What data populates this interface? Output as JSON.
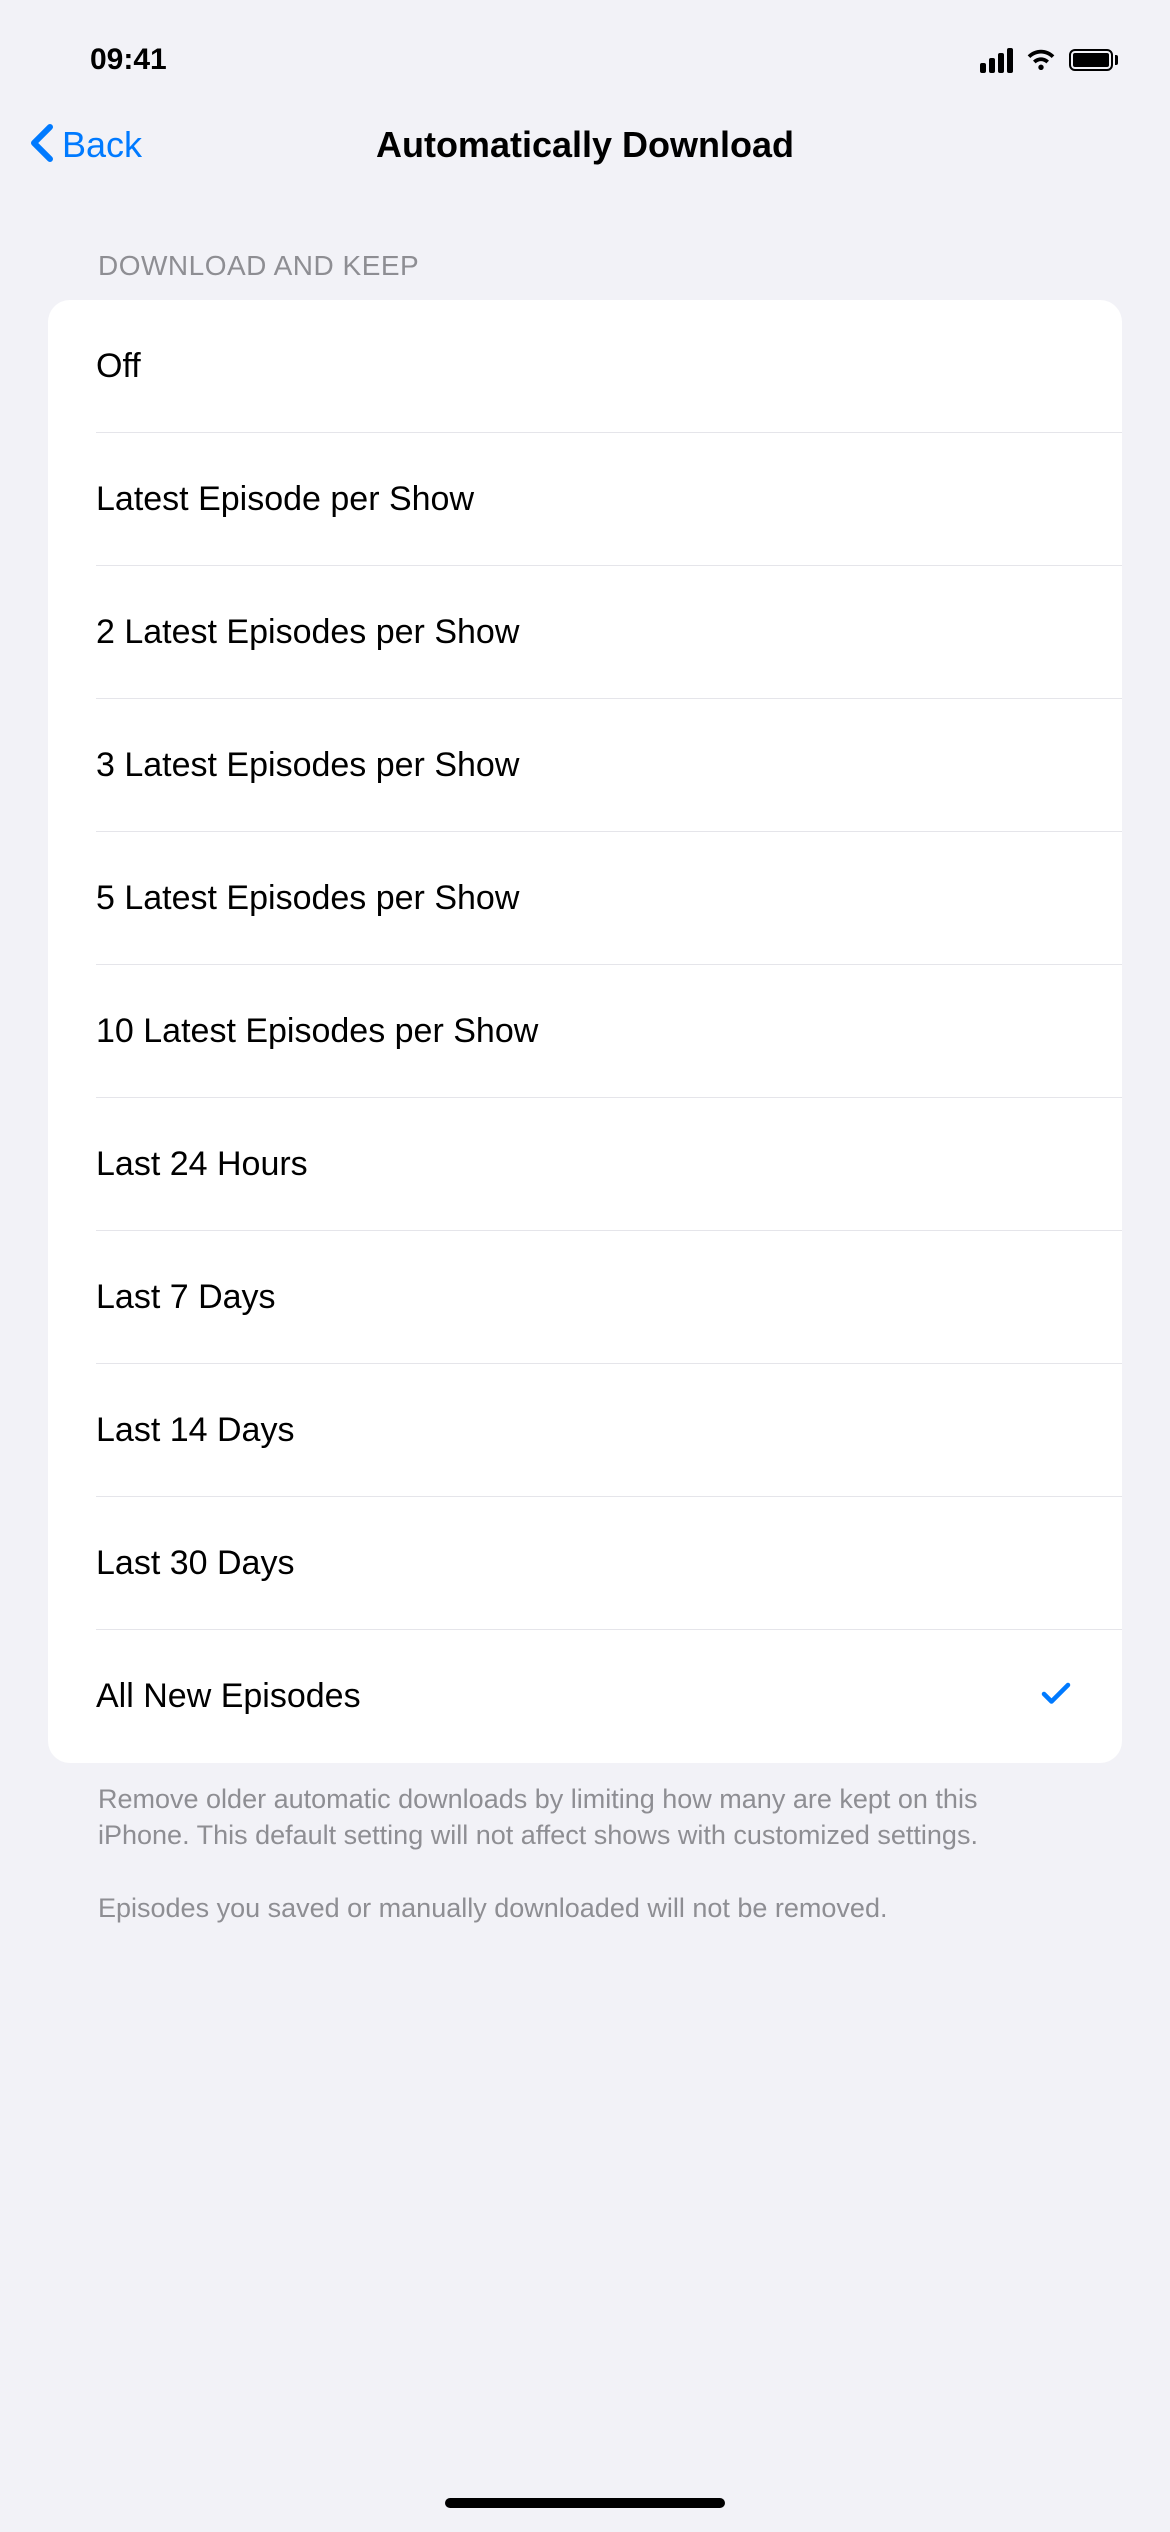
{
  "statusBar": {
    "time": "09:41"
  },
  "navBar": {
    "backLabel": "Back",
    "title": "Automatically Download"
  },
  "section": {
    "header": "DOWNLOAD AND KEEP",
    "options": [
      {
        "label": "Off",
        "selected": false
      },
      {
        "label": "Latest Episode per Show",
        "selected": false
      },
      {
        "label": "2 Latest Episodes per Show",
        "selected": false
      },
      {
        "label": "3 Latest Episodes per Show",
        "selected": false
      },
      {
        "label": "5 Latest Episodes per Show",
        "selected": false
      },
      {
        "label": "10 Latest Episodes per Show",
        "selected": false
      },
      {
        "label": "Last 24 Hours",
        "selected": false
      },
      {
        "label": "Last 7 Days",
        "selected": false
      },
      {
        "label": "Last 14 Days",
        "selected": false
      },
      {
        "label": "Last 30 Days",
        "selected": false
      },
      {
        "label": "All New Episodes",
        "selected": true
      }
    ],
    "footer1": "Remove older automatic downloads by limiting how many are kept on this iPhone. This default setting will not affect shows with customized settings.",
    "footer2": "Episodes you saved or manually downloaded will not be removed."
  }
}
